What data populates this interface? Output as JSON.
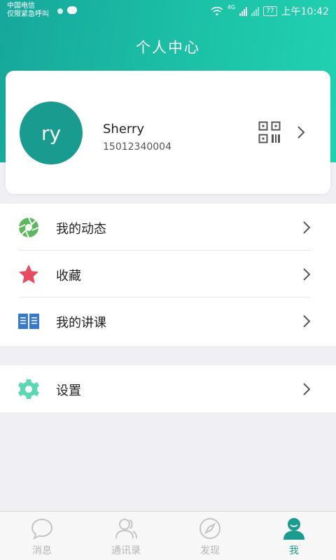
{
  "status_bar": {
    "carrier_line1": "中国电信",
    "carrier_line2": "仅限紧急呼叫",
    "network_label": "4G",
    "battery": "77",
    "time": "上午10:42"
  },
  "header": {
    "title": "个人中心"
  },
  "profile": {
    "avatar_text": "ry",
    "name": "Sherry",
    "phone": "15012340004",
    "qr_icon": "qr-code-icon"
  },
  "menu": [
    {
      "label": "我的动态",
      "icon": "aperture-icon",
      "color": "#5cb85c"
    },
    {
      "label": "收藏",
      "icon": "star-icon",
      "color": "#e84a5f"
    },
    {
      "label": "我的讲课",
      "icon": "book-icon",
      "color": "#3a78c9"
    }
  ],
  "settings": {
    "label": "设置",
    "icon": "gear-icon",
    "color": "#5dd6b4"
  },
  "tabs": [
    {
      "label": "消息",
      "icon": "chat-bubble-icon"
    },
    {
      "label": "通讯录",
      "icon": "contacts-icon"
    },
    {
      "label": "发现",
      "icon": "compass-icon"
    },
    {
      "label": "我",
      "icon": "user-icon"
    }
  ],
  "colors": {
    "accent": "#1a9b8f",
    "header_gradient_start": "#16a79b",
    "header_gradient_end": "#21d2b1",
    "background": "#efeff4"
  }
}
